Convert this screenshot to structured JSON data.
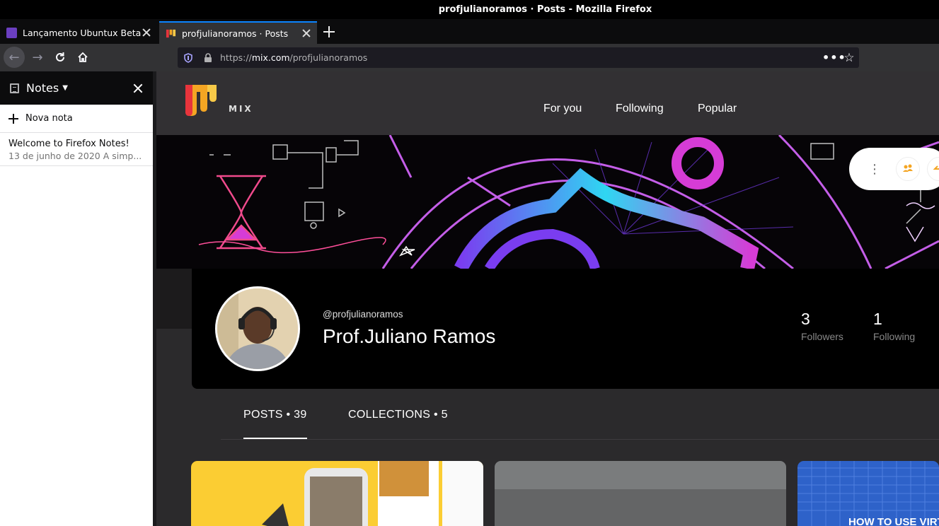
{
  "window": {
    "title": "profjulianoramos · Posts - Mozilla Firefox"
  },
  "tabs": [
    {
      "label": "Lançamento Ubuntux Beta - I",
      "favicon_color": "#6b3fc0"
    },
    {
      "label": "profjulianoramos · Posts",
      "favicon_color": "#f4a523"
    }
  ],
  "navbar": {
    "url_prefix": "https://",
    "url_domain": "mix.com",
    "url_path": "/profjulianoramos",
    "page_actions_icon": "•••"
  },
  "sidebar": {
    "title": "Notes",
    "new_note_label": "Nova nota",
    "notes": [
      {
        "title": "Welcome to Firefox Notes!",
        "meta": "13 de junho de 2020  A simp..."
      }
    ]
  },
  "mix": {
    "brand": "MIX",
    "nav": [
      "For you",
      "Following",
      "Popular"
    ],
    "profile": {
      "handle": "@profjulianoramos",
      "name": "Prof.Juliano Ramos",
      "followers_count": "3",
      "followers_label": "Followers",
      "following_count": "1",
      "following_label": "Following"
    },
    "tabs": {
      "posts": "POSTS • 39",
      "collections": "COLLECTIONS • 5"
    },
    "card_preview_text": "HOW TO USE VIRT"
  },
  "colors": {
    "accent": "#0a84ff",
    "mix_orange": "#f4a523",
    "mix_red": "#e8343c",
    "neon_pink": "#d63cd6",
    "neon_cyan": "#2fd6f2"
  }
}
